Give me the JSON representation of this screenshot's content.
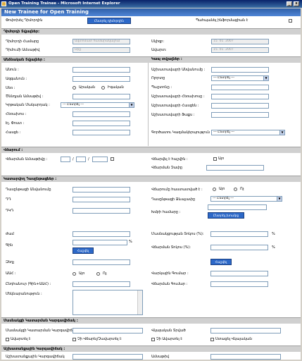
{
  "window": {
    "title": "Open Training Trainee - Microsoft Internet Explorer"
  },
  "page": {
    "heading": "New Trainee for Open Training"
  },
  "top": {
    "left_label": "Փոփոխել Դիմորդին",
    "button": "Ընտրել դիմորդին",
    "right_label": "Պահպանել ինֆորմացիան է"
  },
  "sections": {
    "application": "Դիմորդի Տվյալներ:",
    "personal": "Անձնական Տվյալներ :",
    "contact": "Կապ տվյալներ :",
    "payment": "Վճարում :",
    "courses": "Կատարվող Դասընթացներ :",
    "uni": "Մասնակցի Կատարման Կարգավիճակ :",
    "job": "Աշխատանքային Կարգավիճակ :"
  },
  "application": {
    "code_label": "Դիմորդի Համարը",
    "code_value": "Ավտոմատ համարակալում",
    "date_label": "Դիմումի Ամսաթիվ",
    "date_value": "Օրը",
    "start_label": "Սկիզբ:",
    "start_value": "15. 01. 2007",
    "end_label": "Ավարտ:",
    "end_value": "15. 01. 2007"
  },
  "personal": {
    "name": "Անուն :",
    "surname": "Ազգանուն :",
    "gender": "Սեռ :",
    "male": "Արական",
    "female": "Իգական",
    "birth": "Ծննդյան Ամսաթիվ :",
    "edu": "Կրթական Մակարդակ :",
    "edu_opt": "--- Ընտրել ---",
    "phone": "Հեռախոս :",
    "email": "Էլ. Փոստ :",
    "address": "Հասցե :"
  },
  "contact": {
    "org": "Աշխատավայրի Անվանումը :",
    "field": "Ոլորտը",
    "field_opt": "--- Ընտրել ---",
    "position": "Պաշտոնը :",
    "work_phone": "Աշխատավայրի Հեռախոսը :",
    "work_address": "Աշխատավայրի Հասցեն :",
    "work_fax": "Աշխատավայրի Ֆաքս :",
    "employer": "Գործատու Կազմակերպություն",
    "employer_opt": "--- Ընտրել ---"
  },
  "payment": {
    "card_label": "Վճարման Ամսաթիվը :",
    "sep1": "/",
    "sep2": "/",
    "paid_label": "Վճարվել է հաշվին :",
    "yes": "Այո",
    "sum_label": "Վճարման Չափը"
  },
  "courses": {
    "course": "Դասընթացի Անվանումը",
    "trainer": "ԴԴ",
    "code": "ԴԿԴ",
    "hours": "Ժամ",
    "price": "Գին",
    "calc_btn": "Հաշվել",
    "discount_label": "Զեղչ",
    "tax_label": "ԱԱՀ :",
    "yes": "Այո",
    "no": "Ոչ",
    "total": "Ընդհանուր (Գին+ԱԱՀ) :",
    "comment": "Մեկնաբանություն :",
    "apply_label": "Վճարումը հաստատված է :",
    "apply_yes": "Այո",
    "apply_no": "Ոչ",
    "mode_label": "Դասընթացի Ձևաչափը",
    "mode_opt": "--- Ընտրել ---",
    "group_label": "Խմբի համարը :",
    "group_btn": "Ընտրել խումբը",
    "share_label": "Մասնակցության Տոկոս (%):",
    "pay_label": "Վճարման Տոկոս (%):",
    "calc2_btn": "Հաշվել",
    "credit_label": "Վարկային Գումար :",
    "rest_label": "Վճարման Գումար :"
  },
  "uni": {
    "status_label": "Մասնակցի Կատարման Կարգավիճակ",
    "cert_label": "Վկայական Տրված",
    "chk1": "Ավարտել է",
    "chk2": "Չի Վճարել/Չավարտել է",
    "chk3": "Չի Ավարտել է",
    "chk4": "Ստացել Վկայական"
  },
  "job": {
    "label": "Աշխատանքային Կարգավիճակ",
    "right_label": "Ամսաթիվ"
  }
}
